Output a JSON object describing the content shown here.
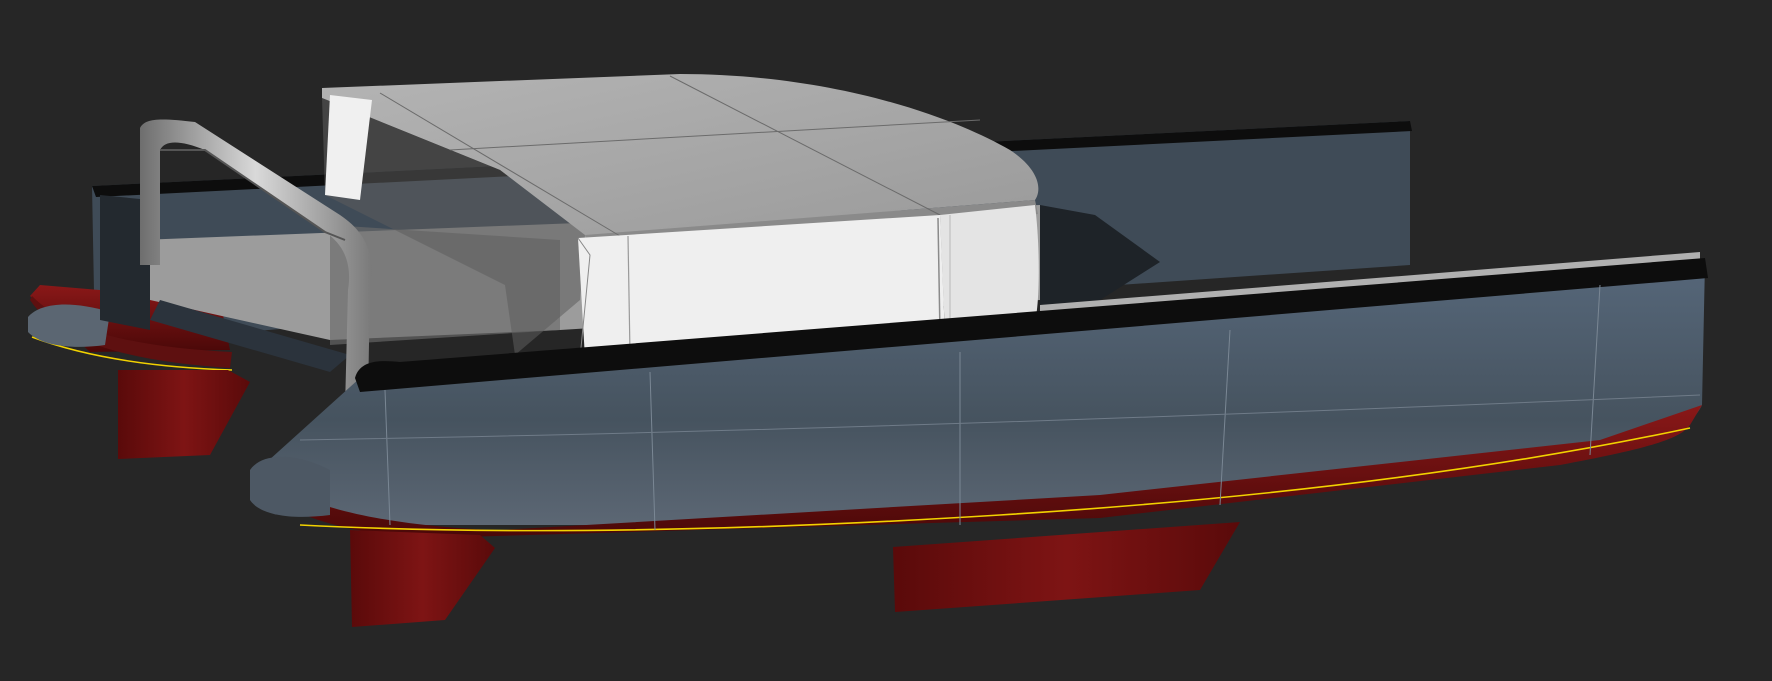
{
  "scene": {
    "subject": "catamaran-3d-render",
    "colors": {
      "background": "#262626",
      "hull": "#4a5868",
      "hull_dark": "#2c3540",
      "antifouling": "#7a1212",
      "appendage": "#6e0f0f",
      "deck": "#a8a8a8",
      "cabin_top": "#a2a2a2",
      "cabin_side": "#ececec",
      "sheer_stripe": "#0d0d0d",
      "waterline": "#f2d200"
    }
  }
}
